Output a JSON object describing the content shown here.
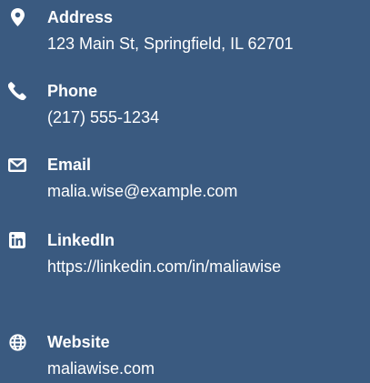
{
  "contacts": [
    {
      "icon": "map-pin-icon",
      "label": "Address",
      "value": "123 Main St, Springfield, IL 62701"
    },
    {
      "icon": "phone-icon",
      "label": "Phone",
      "value": "(217) 555-1234"
    },
    {
      "icon": "envelope-icon",
      "label": "Email",
      "value": "malia.wise@example.com"
    },
    {
      "icon": "linkedin-icon",
      "label": "LinkedIn",
      "value": "https://linkedin.com/in/maliawise"
    },
    {
      "icon": "globe-icon",
      "label": "Website",
      "value": "maliawise.com"
    }
  ],
  "colors": {
    "background": "#3a5a80",
    "text": "#ffffff"
  }
}
